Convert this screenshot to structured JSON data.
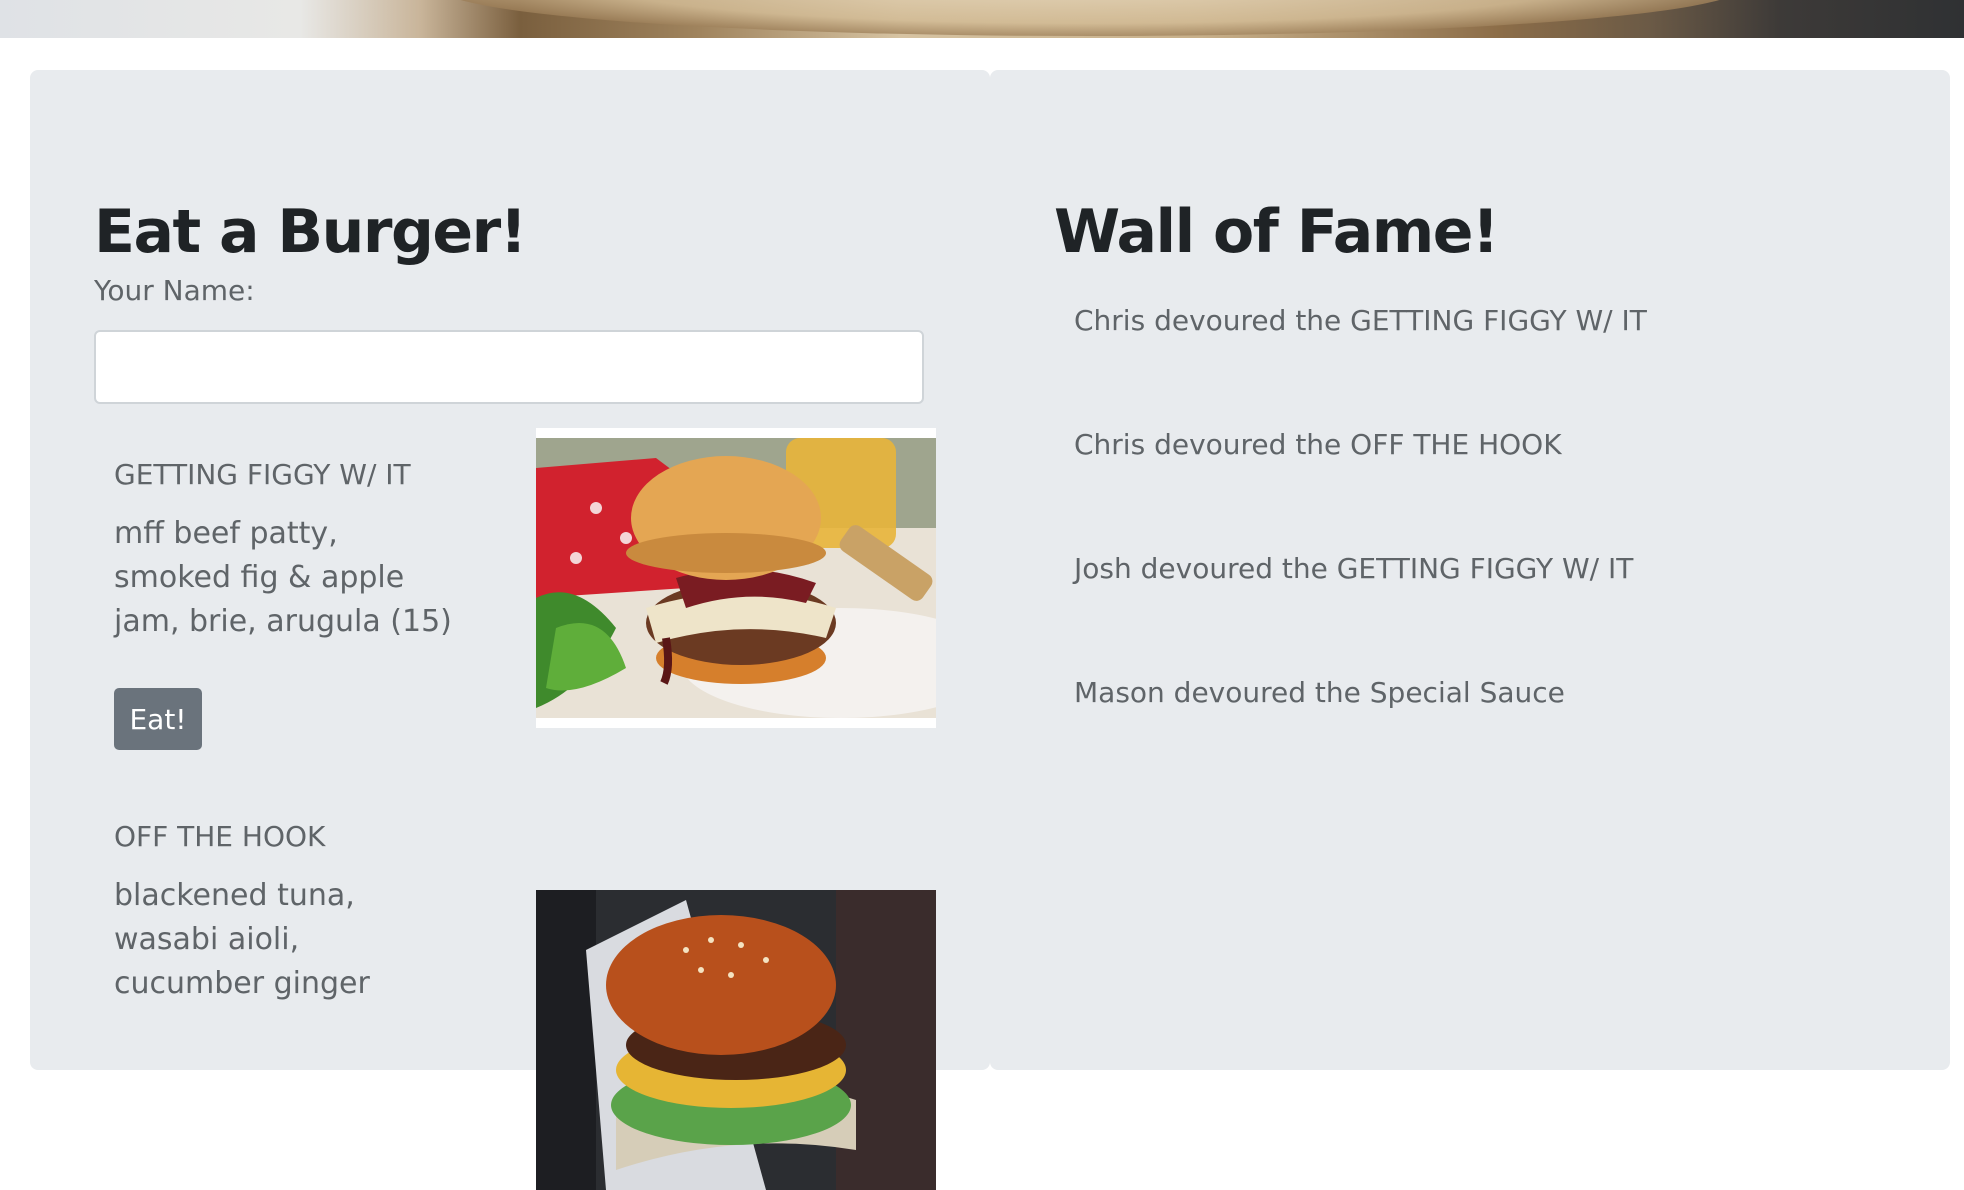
{
  "left_panel": {
    "title": "Eat a Burger!",
    "name_label": "Your Name:",
    "name_input": {
      "value": "",
      "placeholder": ""
    },
    "burgers": [
      {
        "name": "GETTING FIGGY W/ IT",
        "description": "mff beef patty, smoked fig & apple jam, brie, arugula (15)",
        "button_label": "Eat!",
        "photo_icon": "burger-photo"
      },
      {
        "name": "OFF THE HOOK",
        "description": "blackened tuna, wasabi aioli, cucumber ginger",
        "photo_icon": "burger-photo"
      }
    ]
  },
  "right_panel": {
    "title": "Wall of Fame!",
    "entries": [
      "Chris devoured the GETTING FIGGY W/ IT",
      "Chris devoured the OFF THE HOOK",
      "Josh devoured the GETTING FIGGY W/ IT",
      "Mason devoured the Special Sauce"
    ]
  },
  "colors": {
    "panel_background": "#e8ebee",
    "title_text": "#1f2326",
    "body_text": "#5f6468",
    "button_background": "#6a737c",
    "button_text": "#ffffff"
  }
}
